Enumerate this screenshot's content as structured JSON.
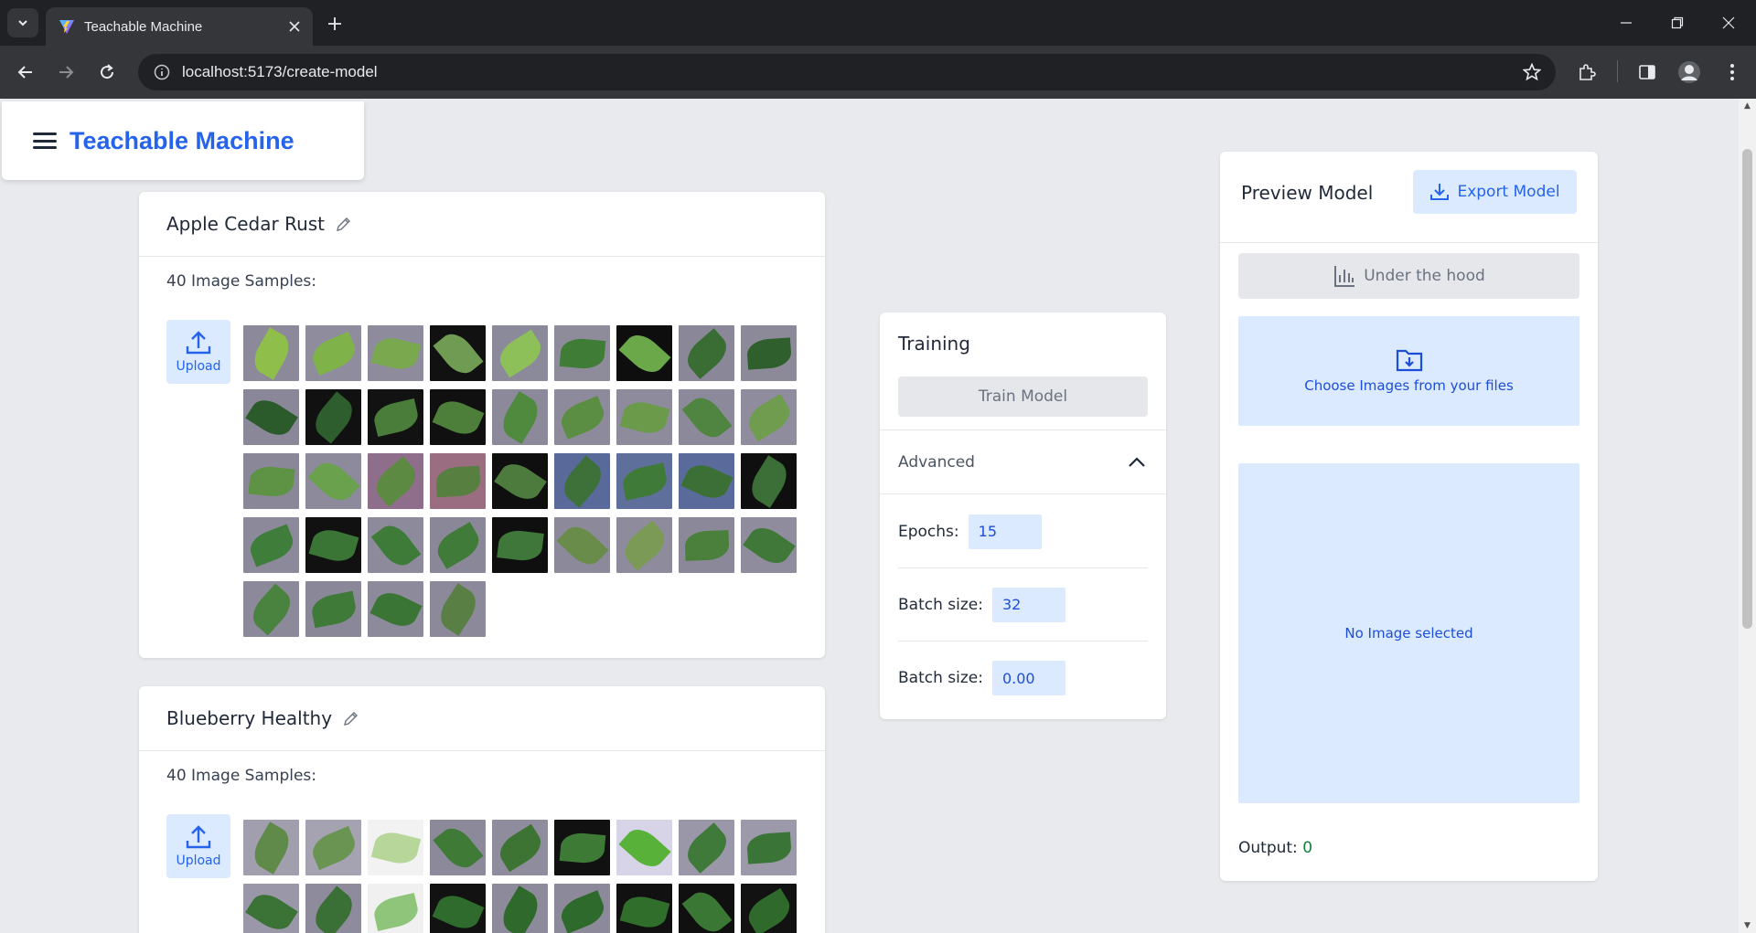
{
  "browser": {
    "tab_title": "Teachable Machine",
    "url": "localhost:5173/create-model"
  },
  "app": {
    "logo_text": "Teachable Machine"
  },
  "classes": [
    {
      "name": "Apple Cedar Rust",
      "samples_label": "40 Image Samples:",
      "upload_label": "Upload",
      "thumbnails": [
        {
          "bg": "#8c8a9a",
          "leaf": "#8fbf4a"
        },
        {
          "bg": "#8f8d9d",
          "leaf": "#7fb34a"
        },
        {
          "bg": "#8d8b9c",
          "leaf": "#7aa84e"
        },
        {
          "bg": "#111111",
          "leaf": "#6f9c52"
        },
        {
          "bg": "#8b8a9a",
          "leaf": "#8ec05a"
        },
        {
          "bg": "#8e8c9b",
          "leaf": "#3f7d36"
        },
        {
          "bg": "#0e0e0e",
          "leaf": "#6aa84a"
        },
        {
          "bg": "#8a8898",
          "leaf": "#3a6d34"
        },
        {
          "bg": "#8c8a99",
          "leaf": "#2f5f2c"
        },
        {
          "bg": "#8a8898",
          "leaf": "#2b5a2b"
        },
        {
          "bg": "#111111",
          "leaf": "#2f5e2e"
        },
        {
          "bg": "#121212",
          "leaf": "#4a7d3a"
        },
        {
          "bg": "#101010",
          "leaf": "#4d7f3b"
        },
        {
          "bg": "#8b899a",
          "leaf": "#4f8a3e"
        },
        {
          "bg": "#8d8b9b",
          "leaf": "#5b8e43"
        },
        {
          "bg": "#8e8c9c",
          "leaf": "#6a9a4a"
        },
        {
          "bg": "#8c8a9a",
          "leaf": "#4f8540"
        },
        {
          "bg": "#8f8d9d",
          "leaf": "#6f9c4f"
        },
        {
          "bg": "#8a8898",
          "leaf": "#5e9244"
        },
        {
          "bg": "#8c8a9b",
          "leaf": "#6aa14c"
        },
        {
          "bg": "#8f6e8c",
          "leaf": "#5d8a43"
        },
        {
          "bg": "#9a6e80",
          "leaf": "#567f40"
        },
        {
          "bg": "#0f0f0f",
          "leaf": "#4d7b3d"
        },
        {
          "bg": "#596a9a",
          "leaf": "#3e7139"
        },
        {
          "bg": "#5f6f9c",
          "leaf": "#3f7a39"
        },
        {
          "bg": "#5a6b9b",
          "leaf": "#3b6f36"
        },
        {
          "bg": "#0f0f0f",
          "leaf": "#3c6e37"
        },
        {
          "bg": "#8b899a",
          "leaf": "#3e7d3a"
        },
        {
          "bg": "#111111",
          "leaf": "#3a7536"
        },
        {
          "bg": "#8d8b9b",
          "leaf": "#3e7a38"
        },
        {
          "bg": "#8a8898",
          "leaf": "#417b3a"
        },
        {
          "bg": "#0f0f0f",
          "leaf": "#3e7739"
        },
        {
          "bg": "#8c8a9a",
          "leaf": "#6a8c4a"
        },
        {
          "bg": "#8e8c9c",
          "leaf": "#7a9a55"
        },
        {
          "bg": "#8b8999",
          "leaf": "#4a7f3c"
        },
        {
          "bg": "#8f8d9d",
          "leaf": "#3f7838"
        },
        {
          "bg": "#8c8a9a",
          "leaf": "#4a8340"
        },
        {
          "bg": "#8a8898",
          "leaf": "#3f7a39"
        },
        {
          "bg": "#8d8b9b",
          "leaf": "#3b7536"
        },
        {
          "bg": "#8b899a",
          "leaf": "#5a7f44"
        }
      ]
    },
    {
      "name": "Blueberry Healthy",
      "samples_label": "40 Image Samples:",
      "upload_label": "Upload",
      "thumbnails": [
        {
          "bg": "#a19fad",
          "leaf": "#5f8a4a"
        },
        {
          "bg": "#a5a3b1",
          "leaf": "#6a9452"
        },
        {
          "bg": "#f2f2f2",
          "leaf": "#b6d69a"
        },
        {
          "bg": "#8c8a9a",
          "leaf": "#3f7a36"
        },
        {
          "bg": "#8f8d9d",
          "leaf": "#3d7434"
        },
        {
          "bg": "#111111",
          "leaf": "#3d7a36"
        },
        {
          "bg": "#d8d4e8",
          "leaf": "#58b23a"
        },
        {
          "bg": "#9a98a8",
          "leaf": "#3f7a3a"
        },
        {
          "bg": "#9c9aaa",
          "leaf": "#3a7436"
        },
        {
          "bg": "#9a98a8",
          "leaf": "#3b7236"
        },
        {
          "bg": "#8e8c9c",
          "leaf": "#3a6f36"
        },
        {
          "bg": "#f0f0f0",
          "leaf": "#8fc57a"
        },
        {
          "bg": "#121212",
          "leaf": "#2f6b2c"
        },
        {
          "bg": "#8d8b9b",
          "leaf": "#2f6a2c"
        },
        {
          "bg": "#8c8a9a",
          "leaf": "#2e6a2b"
        },
        {
          "bg": "#111111",
          "leaf": "#2f6e2b"
        },
        {
          "bg": "#101010",
          "leaf": "#3a7734"
        },
        {
          "bg": "#121212",
          "leaf": "#2f6a2c"
        }
      ]
    }
  ],
  "training": {
    "title": "Training",
    "train_button": "Train Model",
    "advanced_label": "Advanced",
    "epochs_label": "Epochs:",
    "epochs_value": "15",
    "batch_label": "Batch size:",
    "batch_value": "32",
    "lr_label": "Batch size:",
    "lr_value": "0.00"
  },
  "preview": {
    "title": "Preview Model",
    "export_button": "Export Model",
    "hood_button": "Under the hood",
    "choose_label": "Choose Images from your files",
    "no_image_label": "No Image selected",
    "output_label": "Output:",
    "output_value": "0"
  },
  "colors": {
    "brand": "#2563eb",
    "accent_bg": "#dbeafe",
    "output_value": "#15803d"
  }
}
